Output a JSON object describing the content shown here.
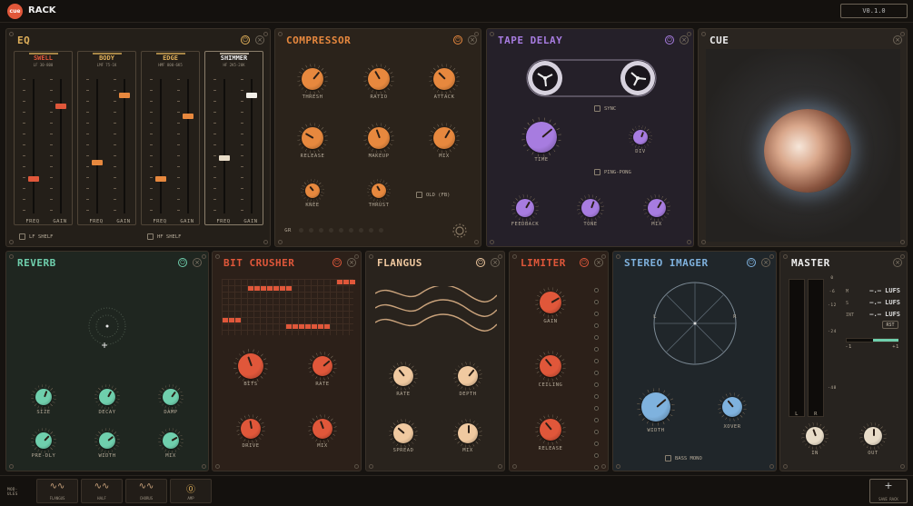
{
  "app": {
    "logo": "cue",
    "title": "RACK",
    "version": "V0.1.0"
  },
  "colors": {
    "eq": "#e0b05a",
    "comp": "#e7883e",
    "tape": "#a77ce0",
    "reverb": "#6fcfad",
    "crusher": "#e0573a",
    "flangus": "#f0c9a0",
    "limiter": "#e0573a",
    "imager": "#7fb2de",
    "master": "#e8dcc8"
  },
  "eq": {
    "title": "EQ",
    "channels": [
      {
        "name": "SWELL",
        "sub": "LF 30-800",
        "fader1": 0.55,
        "fader2": 0.82
      },
      {
        "name": "BODY",
        "sub": "LMF 75-1K",
        "fader1": 0.67,
        "fader2": 0.9
      },
      {
        "name": "EDGE",
        "sub": "HMF 800-6K5",
        "fader1": 0.55,
        "fader2": 0.74
      },
      {
        "name": "SHIMMER",
        "sub": "HF 2K5-20K",
        "fader1": 0.7,
        "fader2": 0.9
      }
    ],
    "freq": "FREQ",
    "gain": "GAIN",
    "lf_shelf": "LF SHELF",
    "hf_shelf": "HF SHELF"
  },
  "comp": {
    "title": "COMPRESSOR",
    "knobs": [
      "THRESH",
      "RATIO",
      "ATTACK",
      "RELEASE",
      "MAKEUP",
      "MIX",
      "KNEE",
      "THRUST"
    ],
    "old": "OLD (FB)",
    "gr": "GR"
  },
  "tape": {
    "title": "TAPE DELAY",
    "sync": "SYNC",
    "time": "TIME",
    "div": "DIV",
    "pingpong": "PING-PONG",
    "feedback": "FEEDBACK",
    "tone": "TONE",
    "mix": "MIX"
  },
  "cue": {
    "title": "CUE"
  },
  "reverb": {
    "title": "REVERB",
    "knobs": [
      "SIZE",
      "DECAY",
      "DAMP",
      "PRE-DLY",
      "WIDTH",
      "MIX"
    ]
  },
  "crusher": {
    "title": "BIT CRUSHER",
    "bits": "BITS",
    "rate": "RATE",
    "drive": "DRIVE",
    "mix": "MIX"
  },
  "flangus": {
    "title": "FLANGUS",
    "rate": "RATE",
    "depth": "DEPTH",
    "spread": "SPREAD",
    "mix": "MIX"
  },
  "limiter": {
    "title": "LIMITER",
    "gain": "GAIN",
    "ceiling": "CEILING",
    "release": "RELEASE"
  },
  "imager": {
    "title": "STEREO IMAGER",
    "width": "WIDTH",
    "xover": "XOVER",
    "bassmono": "BASS MONO",
    "l": "L",
    "r": "R"
  },
  "master": {
    "title": "MASTER",
    "scale": [
      "0",
      "-6",
      "-12",
      "-24",
      "-48"
    ],
    "m": "M",
    "s": "S",
    "int": "INT",
    "mval": "—.— LUFS",
    "sval": "—.— LUFS",
    "intval": "—.— LUFS",
    "rst": "RST",
    "lr_min": "-1",
    "lr_max": "+1",
    "in": "IN",
    "out": "OUT",
    "l": "L",
    "r": "R"
  },
  "bottom": {
    "modules_label": "MOD-ULES",
    "thumbs": [
      "FLANGUS",
      "HALF",
      "CHORUS",
      "AMP"
    ],
    "save": "SAVE RACK",
    "plus": "+"
  }
}
